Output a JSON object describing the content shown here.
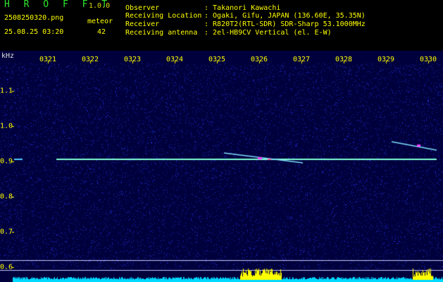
{
  "app": {
    "name": "H R O F F T",
    "version": "1.0.0"
  },
  "file": {
    "name": "2508250320.png",
    "datetime": "25.08.25 03:20"
  },
  "meteor": {
    "label": "meteor",
    "count": "42"
  },
  "info": [
    {
      "label": "Observer",
      "value": ": Takanori Kawachi"
    },
    {
      "label": "Receiving Location",
      "value": ": Ogaki, Gifu, JAPAN (136.60E, 35.35N)"
    },
    {
      "label": "Receiver",
      "value": ": R820T2(RTL-SDR) SDR-Sharp 53.1000MHz"
    },
    {
      "label": "Receiving antenna",
      "value": ": 2el-HB9CV Vertical (el. E-W)"
    }
  ],
  "axis": {
    "unit": "kHz",
    "x_ticks": [
      "0321",
      "0322",
      "0323",
      "0324",
      "0325",
      "0326",
      "0327",
      "0328",
      "0329",
      "0330"
    ],
    "y_ticks": [
      "1.1",
      "1.0",
      "0.9",
      "0.8",
      "0.7",
      "0.6"
    ]
  },
  "colors": {
    "background": "#000000",
    "text": "#ffff00",
    "logo": "#2ee82e",
    "carrier": "#7fffd4",
    "histogram": "#00d8ff",
    "histogram_peak": "#ffff00"
  }
}
